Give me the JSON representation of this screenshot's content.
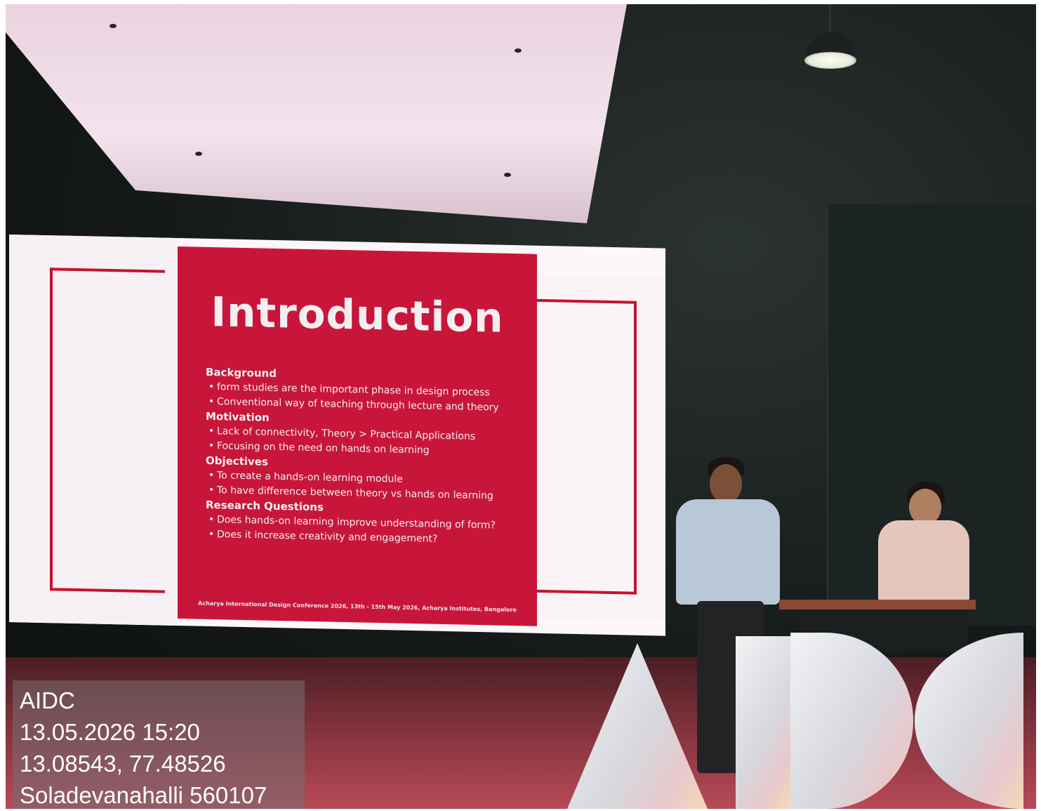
{
  "slide": {
    "title": "Introduction",
    "sections": [
      {
        "heading": "Background",
        "bullets": [
          "form studies are the important phase in design process",
          "Conventional way of teaching through lecture and theory"
        ]
      },
      {
        "heading": "Motivation",
        "bullets": [
          "Lack of connectivity, Theory > Practical Applications",
          "Focusing on the need on hands on learning"
        ]
      },
      {
        "heading": "Objectives",
        "bullets": [
          "To create a hands-on learning module",
          "To have difference between theory vs hands on learning"
        ]
      },
      {
        "heading": "Research Questions",
        "bullets": [
          "Does hands-on learning improve understanding of form?",
          "Does it increase creativity and engagement?"
        ]
      }
    ],
    "footer": "Acharya International Design Conference 2026, 13th - 15th May 2026, Acharya Institutes, Bangalore"
  },
  "stage_sign": {
    "letters": "AIDC"
  },
  "photo_stamp": {
    "line1": "AIDC",
    "line2": "13.05.2026 15:20",
    "line3": "13.08543, 77.48526",
    "line4": "Soladevanahalli 560107"
  },
  "colors": {
    "slide_red": "#c8163a",
    "frame_red": "#c4142e",
    "screen_white": "#fdf7f9"
  }
}
